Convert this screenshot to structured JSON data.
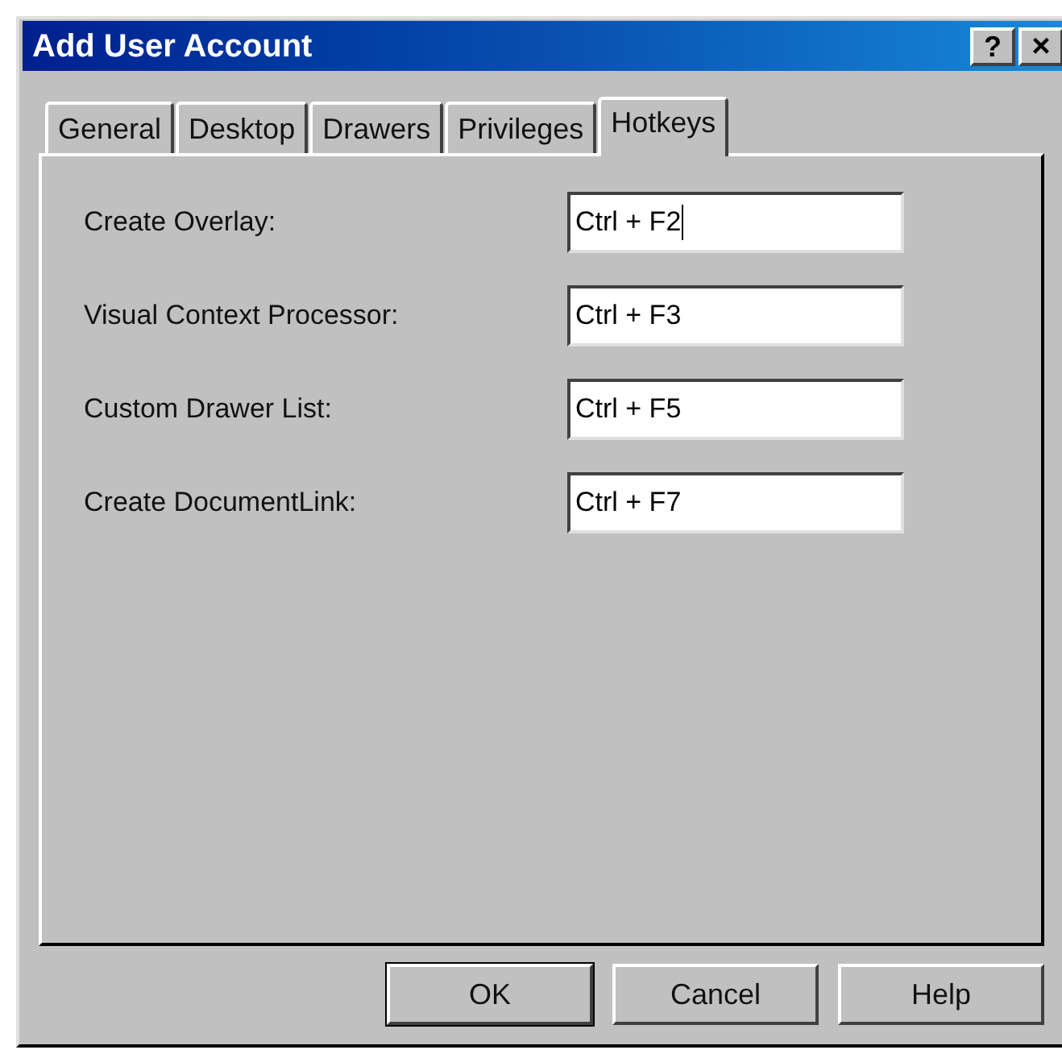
{
  "window": {
    "title": "Add User Account",
    "help_button": "?",
    "close_button": "×"
  },
  "tabs": [
    {
      "label": "General",
      "selected": false
    },
    {
      "label": "Desktop",
      "selected": false
    },
    {
      "label": "Drawers",
      "selected": false
    },
    {
      "label": "Privileges",
      "selected": false
    },
    {
      "label": "Hotkeys",
      "selected": true
    }
  ],
  "hotkeys": [
    {
      "label": "Create Overlay:",
      "value": "Ctrl + F2",
      "focused": true
    },
    {
      "label": "Visual Context Processor:",
      "value": "Ctrl + F3",
      "focused": false
    },
    {
      "label": "Custom Drawer List:",
      "value": "Ctrl + F5",
      "focused": false
    },
    {
      "label": "Create DocumentLink:",
      "value": "Ctrl + F7",
      "focused": false
    }
  ],
  "buttons": [
    {
      "label": "OK",
      "default": true
    },
    {
      "label": "Cancel",
      "default": false
    },
    {
      "label": "Help",
      "default": false
    }
  ]
}
